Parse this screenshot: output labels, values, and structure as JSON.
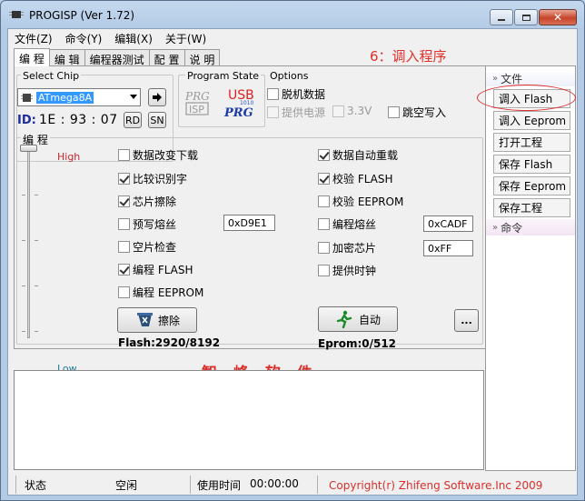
{
  "window": {
    "title": "PROGISP (Ver 1.72)"
  },
  "menu": [
    "文件(Z)",
    "命令(Y)",
    "编辑(X)",
    "关于(W)"
  ],
  "tabs": [
    "编 程",
    "编 辑",
    "编程器测试",
    "配 置",
    "说 明"
  ],
  "chip": {
    "group_label": "Select Chip",
    "selected": "ATmega8A",
    "id_label": "ID:",
    "id_value": "1E : 93 : 07",
    "rd_label": "RD",
    "sn_label": "SN"
  },
  "program_state": {
    "label": "Program State",
    "prg_isp_logo": "PRG ISP",
    "usb_prg_logo": "USB PRG"
  },
  "options": {
    "label": "Options",
    "items": [
      {
        "label": "脱机数据",
        "checked": false,
        "enabled": true
      },
      {
        "label": "提供电源",
        "checked": false,
        "enabled": false
      },
      {
        "label": "3.3V",
        "checked": false,
        "enabled": false
      },
      {
        "label": "跳空写入",
        "checked": false,
        "enabled": true
      }
    ]
  },
  "program": {
    "group_label": "编 程",
    "speed_high": "High",
    "speed_low": "Low",
    "left_checks": [
      {
        "label": "数据改变下载",
        "checked": false
      },
      {
        "label": "比较识别字",
        "checked": true
      },
      {
        "label": "芯片擦除",
        "checked": true
      },
      {
        "label": "预写熔丝",
        "checked": false
      },
      {
        "label": "空片检查",
        "checked": false
      },
      {
        "label": "编程 FLASH",
        "checked": true
      },
      {
        "label": "编程 EEPROM",
        "checked": false
      }
    ],
    "right_checks": [
      {
        "label": "数据自动重载",
        "checked": true
      },
      {
        "label": "校验 FLASH",
        "checked": true
      },
      {
        "label": "校验 EEPROM",
        "checked": false
      },
      {
        "label": "编程熔丝",
        "checked": false
      },
      {
        "label": "加密芯片",
        "checked": false
      },
      {
        "label": "提供时钟",
        "checked": false
      }
    ],
    "prewrite_fuse_value": "0xD9E1",
    "program_fuse_value": "0xCADF",
    "lock_value": "0xFF",
    "erase_button": "擦除",
    "auto_button": "自动",
    "more_button": "...",
    "flash_status": "Flash:2920/8192",
    "eprom_status": "Eprom:0/512"
  },
  "sidebar": {
    "file_header": "文件",
    "buttons": [
      "调入 Flash",
      "调入 Eeprom",
      "打开工程",
      "保存 Flash",
      "保存 Eeprom",
      "保存工程"
    ],
    "command_header": "命令"
  },
  "annotation": {
    "line1": "6：调入程序",
    "line2": "文件",
    "watermark": "智 峰 软 件"
  },
  "statusbar": {
    "state_label": "状态",
    "state_value": "空闲",
    "time_label": "使用时间",
    "time_value": "00:00:00",
    "copyright": "Copyright(r) Zhifeng Software.Inc 2009"
  },
  "colors": {
    "accent_red": "#e0302c",
    "titlebar": "#c4d9ef",
    "selection": "#3399ff"
  }
}
